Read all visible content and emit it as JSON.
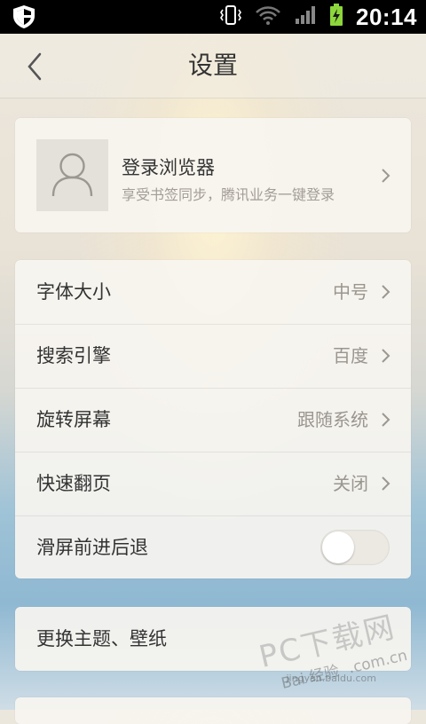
{
  "status_bar": {
    "time": "20:14",
    "icons": [
      "shield-app-icon",
      "vibrate-icon",
      "wifi-icon",
      "signal-icon",
      "battery-charging-icon"
    ]
  },
  "nav": {
    "title": "设置",
    "back_icon": "back-chevron-icon"
  },
  "login": {
    "title": "登录浏览器",
    "subtitle": "享受书签同步，腾讯业务一键登录",
    "avatar_icon": "user-avatar-icon"
  },
  "settings": [
    {
      "label": "字体大小",
      "value": "中号"
    },
    {
      "label": "搜索引擎",
      "value": "百度"
    },
    {
      "label": "旋转屏幕",
      "value": "跟随系统"
    },
    {
      "label": "快速翻页",
      "value": "关闭"
    },
    {
      "label": "滑屏前进后退",
      "toggle": false
    }
  ],
  "theme": {
    "label": "更换主题、壁纸"
  },
  "watermark": {
    "site": "PC下载网",
    "baidu": "Bai 经验",
    "com": ".com.cn",
    "url": "jingyan.baidu.com"
  },
  "colors": {
    "accent_green": "#8dd63b",
    "text_primary": "#333333",
    "text_secondary": "#9a958f"
  }
}
